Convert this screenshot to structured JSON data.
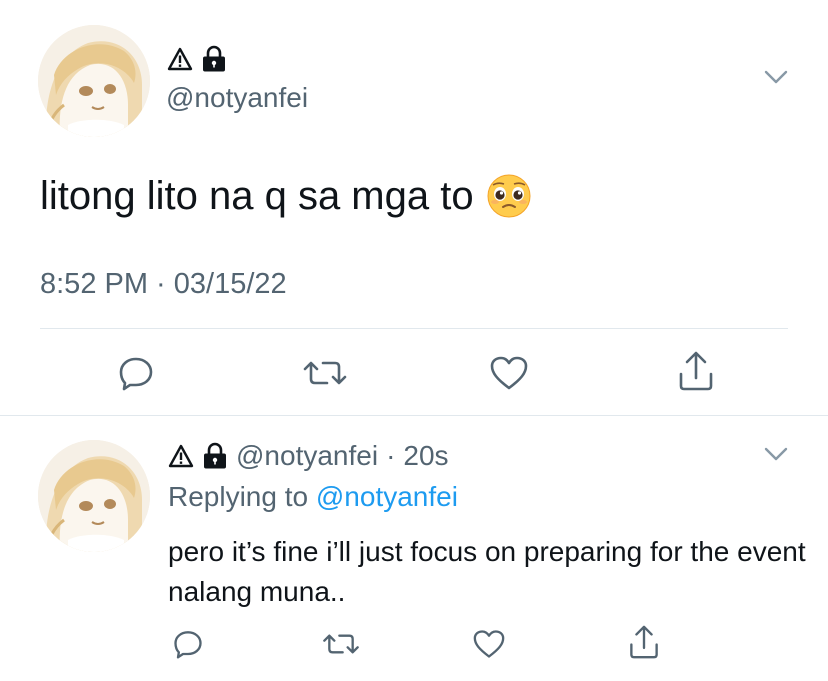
{
  "main_tweet": {
    "handle": "@notyanfei",
    "badges": [
      "warning-icon",
      "lock-icon"
    ],
    "text": "litong lito na q sa mga to",
    "emoji": "pleading-face-emoji",
    "timestamp": "8:52 PM · 03/15/22",
    "actions": [
      "reply-icon",
      "retweet-icon",
      "like-icon",
      "share-icon"
    ]
  },
  "reply_tweet": {
    "handle": "@notyanfei",
    "separator": "·",
    "age": "20s",
    "badges": [
      "warning-icon",
      "lock-icon"
    ],
    "replying_prefix": "Replying to ",
    "replying_handle": "@notyanfei",
    "text": "pero it’s fine i’ll just focus on preparing for the event nalang muna..",
    "actions": [
      "reply-icon",
      "retweet-icon",
      "like-icon",
      "share-icon"
    ]
  },
  "colors": {
    "text_primary": "#0f1419",
    "text_secondary": "#536471",
    "link": "#1d9bf0",
    "divider": "#e1e8ed"
  }
}
